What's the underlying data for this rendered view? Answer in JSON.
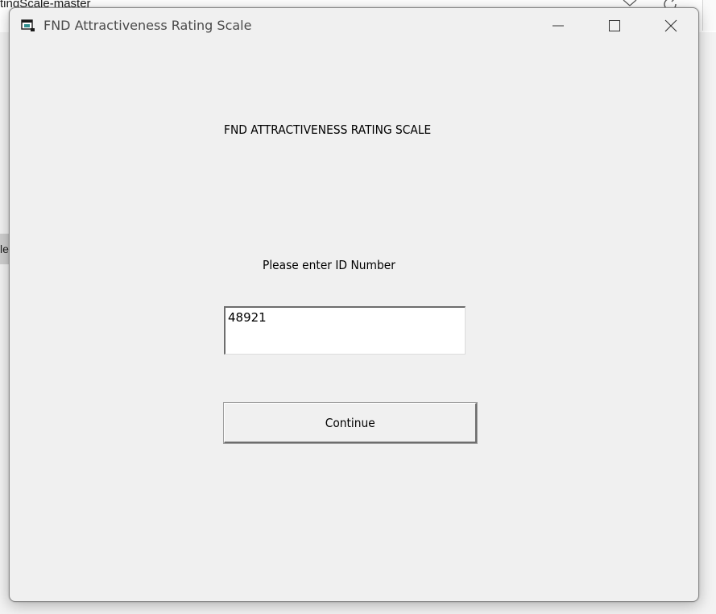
{
  "background": {
    "title_fragment": "tingScale-master",
    "side_tab_fragment": "le"
  },
  "window": {
    "title": "FND Attractiveness Rating Scale",
    "controls": {
      "minimize_icon": "minimize-icon",
      "maximize_icon": "maximize-icon",
      "close_icon": "close-icon"
    }
  },
  "form": {
    "heading": "FND ATTRACTIVENESS RATING SCALE",
    "prompt": "Please enter ID Number",
    "id_value": "48921",
    "continue_label": "Continue"
  },
  "colors": {
    "window_bg": "#f0f0f0",
    "title_text": "#4a4a4a",
    "field_bg": "#ffffff"
  }
}
